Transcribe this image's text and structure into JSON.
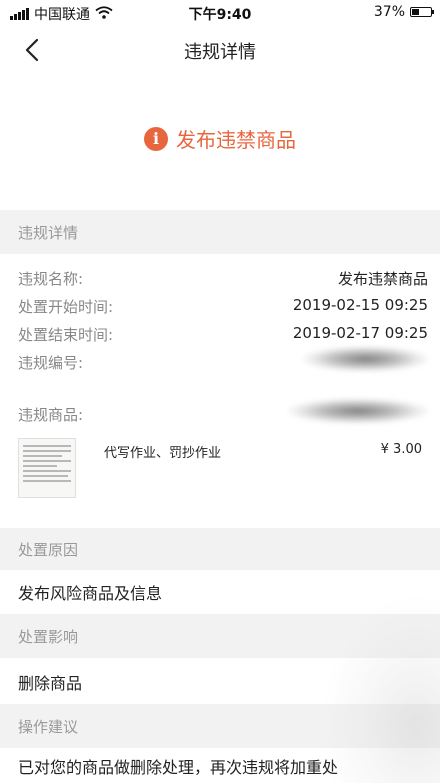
{
  "status_bar": {
    "carrier": "中国联通",
    "time": "下午9:40",
    "battery": "37%",
    "battery_level": 0.37
  },
  "nav": {
    "title": "违规详情"
  },
  "violation": {
    "title": "发布违禁商品",
    "accent_color": "#e8663d"
  },
  "details": {
    "section_title": "违规详情",
    "rows": [
      {
        "label": "违规名称:",
        "value": "发布违禁商品"
      },
      {
        "label": "处置开始时间:",
        "value": "2019-02-15 09:25"
      },
      {
        "label": "处置结束时间:",
        "value": "2019-02-17 09:25"
      },
      {
        "label": "违规编号:",
        "value": ""
      },
      {
        "label": "违规商品:",
        "value": ""
      }
    ],
    "product": {
      "name": "代写作业、罚抄作业",
      "price": "¥ 3.00"
    }
  },
  "reason": {
    "section_title": "处置原因",
    "text": "发布风险商品及信息"
  },
  "impact": {
    "section_title": "处置影响",
    "text": "删除商品"
  },
  "suggestion": {
    "section_title": "操作建议",
    "text": "已对您的商品做删除处理，再次违规将加重处"
  },
  "icons": {
    "back": "chevron-left-icon",
    "info": "info-icon",
    "wifi": "wifi-icon",
    "signal": "signal-icon",
    "battery": "battery-icon"
  }
}
